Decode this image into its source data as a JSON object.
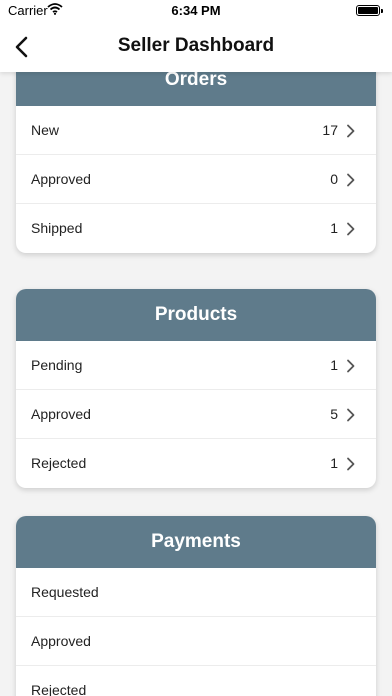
{
  "status_bar": {
    "carrier": "Carrier",
    "time": "6:34 PM"
  },
  "nav": {
    "title": "Seller Dashboard"
  },
  "sections": [
    {
      "title": "Orders",
      "rows": [
        {
          "label": "New",
          "count": "17"
        },
        {
          "label": "Approved",
          "count": "0"
        },
        {
          "label": "Shipped",
          "count": "1"
        }
      ]
    },
    {
      "title": "Products",
      "rows": [
        {
          "label": "Pending",
          "count": "1"
        },
        {
          "label": "Approved",
          "count": "5"
        },
        {
          "label": "Rejected",
          "count": "1"
        }
      ]
    },
    {
      "title": "Payments",
      "rows": [
        {
          "label": "Requested"
        },
        {
          "label": "Approved"
        },
        {
          "label": "Rejected"
        }
      ]
    }
  ],
  "colors": {
    "section_header": "#5f7b8b",
    "background": "#f3f3f3"
  },
  "icons": {
    "back": "chevron-left-icon",
    "row_disclosure": "chevron-right-icon"
  }
}
